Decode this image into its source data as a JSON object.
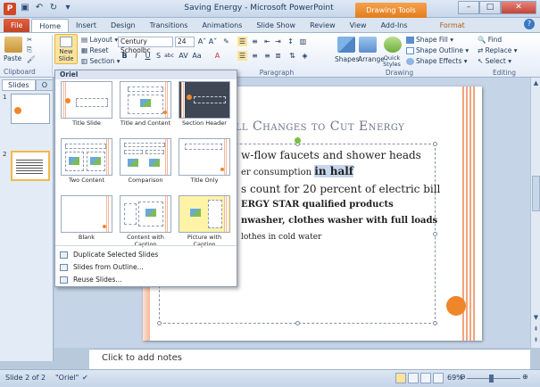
{
  "window": {
    "title": "Saving Energy - Microsoft PowerPoint",
    "context_tab": "Drawing Tools"
  },
  "tabs": [
    {
      "label": "File"
    },
    {
      "label": "Home"
    },
    {
      "label": "Insert"
    },
    {
      "label": "Design"
    },
    {
      "label": "Transitions"
    },
    {
      "label": "Animations"
    },
    {
      "label": "Slide Show"
    },
    {
      "label": "Review"
    },
    {
      "label": "View"
    },
    {
      "label": "Add-Ins"
    },
    {
      "label": "Format"
    }
  ],
  "ribbon": {
    "clipboard": {
      "paste": "Paste",
      "label": "Clipboard"
    },
    "slides": {
      "new_slide": "New Slide",
      "layout": "Layout",
      "reset": "Reset",
      "section": "Section"
    },
    "font": {
      "name": "Century Schoolbc",
      "size": "24"
    },
    "paragraph": {
      "label": "Paragraph"
    },
    "drawing": {
      "shapes": "Shapes",
      "arrange": "Arrange",
      "quick_styles": "Quick Styles",
      "shape_fill": "Shape Fill",
      "shape_outline": "Shape Outline",
      "shape_effects": "Shape Effects",
      "label": "Drawing"
    },
    "editing": {
      "find": "Find",
      "replace": "Replace",
      "select": "Select",
      "label": "Editing"
    }
  },
  "left_panel": {
    "tab_slides": "Slides",
    "tab_outline": "O",
    "thumbs": [
      {
        "num": "1"
      },
      {
        "num": "2"
      }
    ]
  },
  "gallery": {
    "header": "Oriel",
    "layouts": [
      {
        "label": "Title Slide"
      },
      {
        "label": "Title and Content"
      },
      {
        "label": "Section Header"
      },
      {
        "label": "Two Content"
      },
      {
        "label": "Comparison"
      },
      {
        "label": "Title Only"
      },
      {
        "label": "Blank"
      },
      {
        "label": "Content with Caption"
      },
      {
        "label": "Picture with Caption"
      }
    ],
    "actions": [
      {
        "label": "Duplicate Selected Slides"
      },
      {
        "label": "Slides from Outline..."
      },
      {
        "label": "Reuse Slides..."
      }
    ]
  },
  "slide": {
    "title": "all Changes to Cut Energy",
    "bullets": [
      {
        "text": "w-flow faucets and shower heads",
        "level": 1
      },
      {
        "text_before": "er consumption ",
        "text_highlight": "in half",
        "level": 2
      },
      {
        "text": "s count for 20 percent of electric bill",
        "level": 1
      },
      {
        "text": "ERGY STAR qualified products",
        "level": 3
      },
      {
        "text": "nwasher, clothes washer with full loads",
        "level": 2
      },
      {
        "text": "lothes in cold water",
        "level": 4
      }
    ]
  },
  "notes": {
    "placeholder": "Click to add notes"
  },
  "status": {
    "slide_info": "Slide 2 of 2",
    "theme": "\"Oriel\"",
    "zoom": "69%"
  },
  "colors": {
    "accent_orange": "#f0862a",
    "file_tab": "#c04526",
    "selection": "#c7d7ec"
  }
}
